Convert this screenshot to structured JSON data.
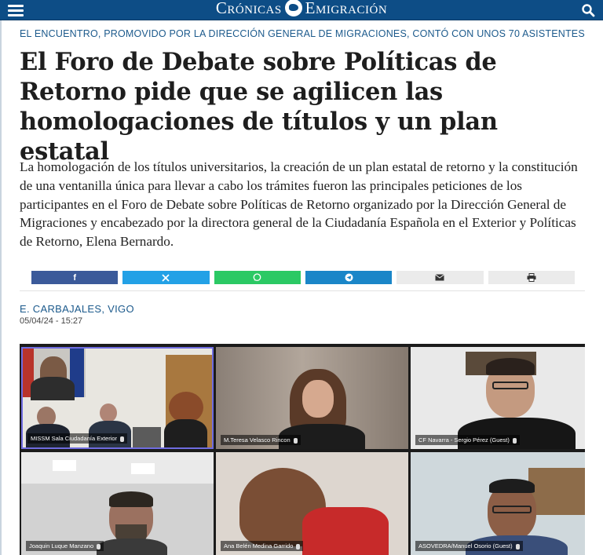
{
  "header": {
    "logo_left": "Crónicas",
    "logo_right": "Emigración",
    "menu_icon": "hamburger-menu-icon",
    "search_icon": "search-icon",
    "colors": {
      "bar": "#0d4d86",
      "accent_text": "#1c5a8c"
    }
  },
  "article": {
    "kicker": "EL ENCUENTRO, PROMOVIDO POR LA DIRECCIÓN GENERAL DE MIGRACIONES, CONTÓ CON UNOS 70 ASISTENTES",
    "headline": "El Foro de Debate sobre Políticas de Retorno pide que se agilicen las homologaciones de títulos y un plan estatal",
    "lead": "La homologación de los títulos universitarios, la creación de un plan estatal de retorno y la constitución de una ventanilla única para llevar a cabo los trámites fueron las principales peticiones de los participantes en el Foro de Debate sobre Políticas de Retorno organizado por la Dirección General de Migraciones y encabezado por la directora general de la Ciudadanía Española en el Exterior y Políticas de Retorno, Elena Bernardo.",
    "byline": "E. CARBAJALES, VIGO",
    "date": "05/04/24 - 15:27"
  },
  "share": {
    "buttons": [
      {
        "name": "facebook",
        "icon": "f",
        "color": "#3b5a9a"
      },
      {
        "name": "x",
        "icon": "𝕏",
        "color": "#23a1e6"
      },
      {
        "name": "whatsapp",
        "icon": "✆",
        "color": "#2bc964"
      },
      {
        "name": "telegram",
        "icon": "➤",
        "color": "#1a86c8"
      },
      {
        "name": "email",
        "icon": "✉",
        "color": "#ebebeb"
      },
      {
        "name": "print",
        "icon": "⎙",
        "color": "#ebebeb"
      }
    ]
  },
  "photo": {
    "tiles": [
      {
        "label": "MISSM Sala Ciudadanía Exterior"
      },
      {
        "label": "M.Teresa Velasco Rincon"
      },
      {
        "label": "CF Navarra - Sergio Pérez (Guest)"
      },
      {
        "label": "Joaquin Luque Manzano"
      },
      {
        "label": "Ana Belén Medina Garrido"
      },
      {
        "label": "ASOVEDRA/Manuel Osorio (Guest)"
      }
    ]
  }
}
